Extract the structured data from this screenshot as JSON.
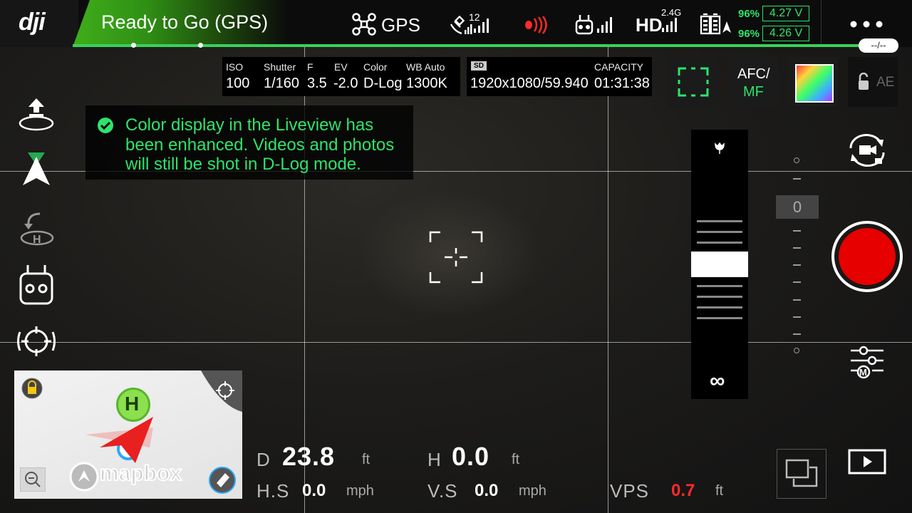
{
  "status": {
    "brand": "dji",
    "text": "Ready to Go (GPS)"
  },
  "topbar": {
    "gps_label": "GPS",
    "satellite_count": "12",
    "hd_label": "HD",
    "hd_band": "2.4G",
    "battery": [
      {
        "percent": "96%",
        "voltage": "4.27 V"
      },
      {
        "percent": "96%",
        "voltage": "4.26 V"
      }
    ],
    "timer": "--/--"
  },
  "camera": {
    "iso_label": "ISO",
    "iso": "100",
    "shutter_label": "Shutter",
    "shutter": "1/160",
    "f_label": "F",
    "f": "3.5",
    "ev_label": "EV",
    "ev": "-2.0",
    "color_label": "Color",
    "color": "D-Log",
    "wb_label": "WB  Auto",
    "wb": "1300K",
    "sd_label": "SD",
    "resolution": "1920x1080/59.940",
    "capacity_label": "CAPACITY",
    "capacity": "01:31:38",
    "focus_mode_line1": "AFC/",
    "focus_mode_line2": "MF",
    "ae_label": "AE"
  },
  "toast": {
    "message": "Color display in the Liveview has been enhanced. Videos and photos will still be shot in D-Log mode."
  },
  "exposure": {
    "value": "0"
  },
  "focus": {
    "infinity": "∞"
  },
  "map": {
    "home_label": "H",
    "brand": "mapbox"
  },
  "telemetry": {
    "d_label": "D",
    "d_value": "23.8",
    "d_unit": "ft",
    "h_label": "H",
    "h_value": "0.0",
    "h_unit": "ft",
    "hs_label": "H.S",
    "hs_value": "0.0",
    "hs_unit": "mph",
    "vs_label": "V.S",
    "vs_value": "0.0",
    "vs_unit": "mph",
    "vps_label": "VPS",
    "vps_value": "0.7",
    "vps_unit": "ft"
  },
  "colors": {
    "accent": "#2ee36b",
    "record": "#e60000",
    "warning": "#ff2a2a"
  }
}
